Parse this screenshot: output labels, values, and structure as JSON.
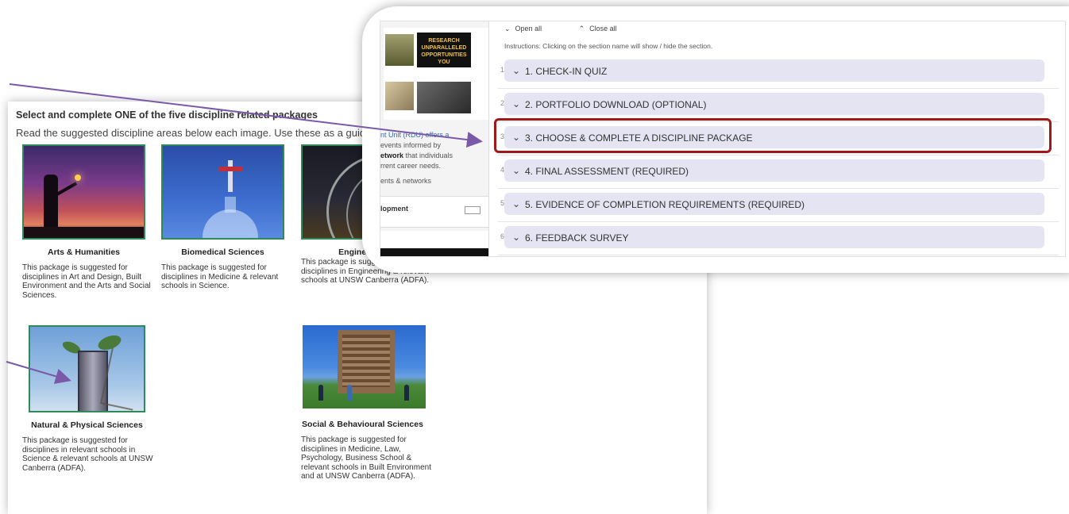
{
  "packages_page": {
    "title": "Select and complete ONE of the five discipline related packages",
    "subtitle": "Read the suggested discipline areas below each image. Use these as a guide to",
    "packages": [
      {
        "name": "Arts & Humanities",
        "description": "This package is suggested for disciplines in Art and Design, Built Environment and the Arts and Social Sciences."
      },
      {
        "name": "Biomedical Sciences",
        "description": "This package is suggested for disciplines in Medicine & relevant schools in Science."
      },
      {
        "name": "Engineering",
        "description": "This package is suggested for disciplines in   Engineering & relevant schools at UNSW Canberra (ADFA)."
      },
      {
        "name": "Natural & Physical Sciences",
        "description": "This package is suggested for disciplines in relevant schools in Science & relevant schools at UNSW Canberra (ADFA)."
      },
      {
        "name": "Social & Behavioural Sciences",
        "description": "This package is suggested for disciplines in Medicine, Law, Psychology, Business School & relevant schools in Built Environment and at UNSW Canberra (ADFA)."
      }
    ]
  },
  "course_page": {
    "open_all": "Open all",
    "close_all": "Close all",
    "instructions": "Instructions: Clicking on the section name will show / hide the section.",
    "sidebar": {
      "banner_text": "RESEARCH UNPARALLELED OPPORTUNITIES YOU",
      "text_line1": "nt Unit (RDU) offers a",
      "text_line2": "events informed by",
      "text_line3_bold": "etwork",
      "text_line3_rest": " that individuals",
      "text_line4": "rrent career needs.",
      "text_line5": "ents & networks",
      "block_title": "lopment"
    },
    "sections": [
      {
        "number": "1",
        "label": "1. CHECK-IN QUIZ"
      },
      {
        "number": "2",
        "label": "2. PORTFOLIO DOWNLOAD (OPTIONAL)"
      },
      {
        "number": "3",
        "label": "3. CHOOSE & COMPLETE A DISCIPLINE PACKAGE"
      },
      {
        "number": "4",
        "label": "4. FINAL ASSESSMENT (REQUIRED)"
      },
      {
        "number": "5",
        "label": "5. EVIDENCE OF COMPLETION REQUIREMENTS (REQUIRED)"
      },
      {
        "number": "6",
        "label": "6. FEEDBACK SURVEY"
      }
    ],
    "highlight_color": "#a01818",
    "section_bar_color": "#e4e4f2"
  },
  "icons": {
    "chevron_down": "chevron-down-icon",
    "chevron_up": "chevron-up-icon",
    "arrow": "arrow-icon"
  },
  "arrow_color": "#7a5aa8"
}
